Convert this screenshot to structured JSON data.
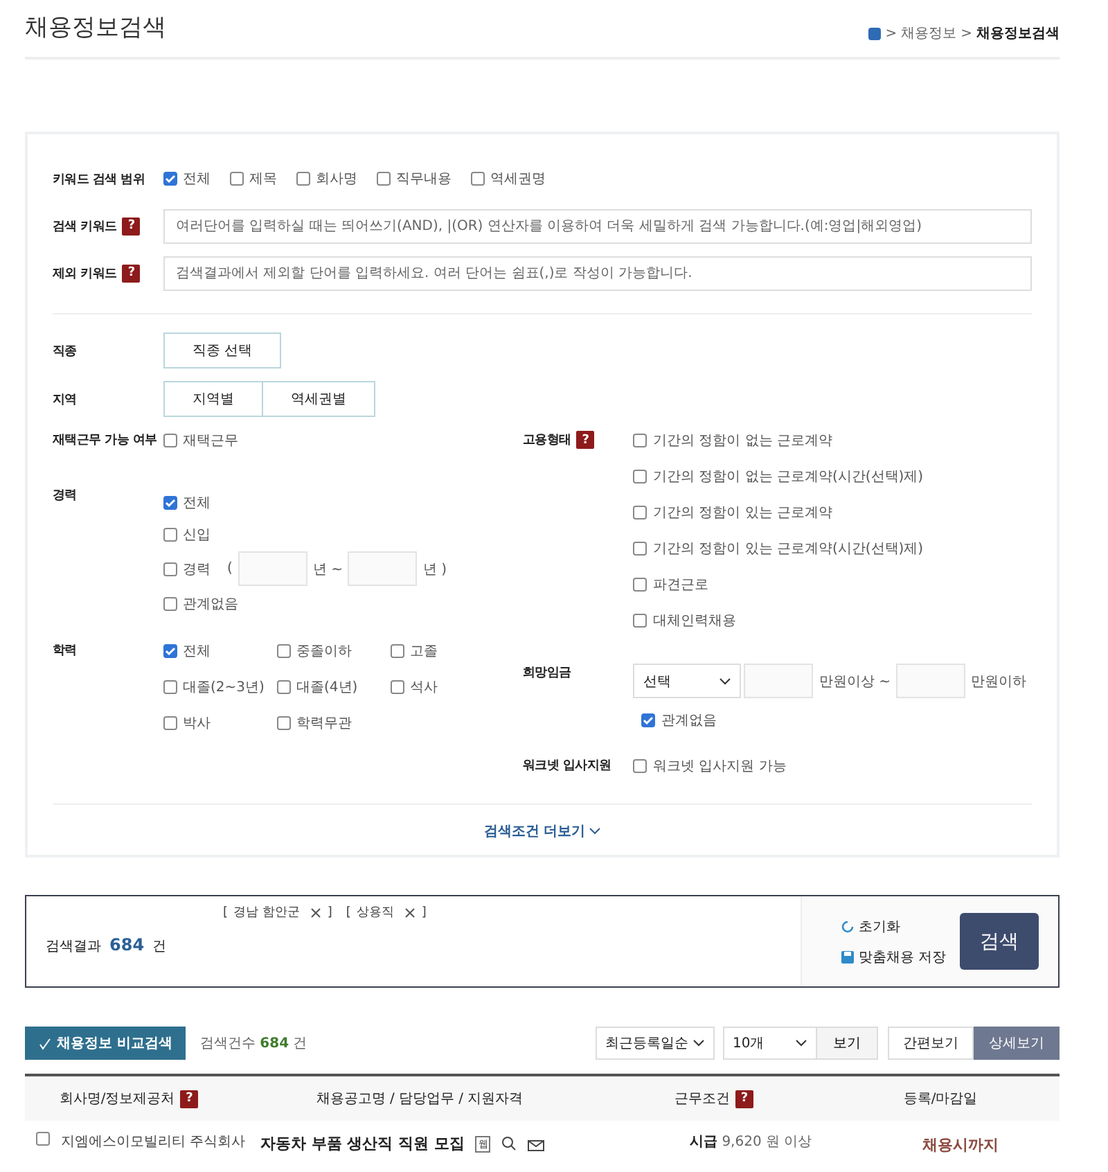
{
  "title": "채용정보검색",
  "breadcrumb": [
    {
      "sep": ">",
      "label": "채용정보"
    },
    {
      "sep": ">",
      "label": "채용정보검색"
    }
  ],
  "keyword_scope": {
    "label": "키워드 검색 범위",
    "options": [
      {
        "label": "전체",
        "checked": true
      },
      {
        "label": "제목",
        "checked": false
      },
      {
        "label": "회사명",
        "checked": false
      },
      {
        "label": "직무내용",
        "checked": false
      },
      {
        "label": "역세권명",
        "checked": false
      }
    ]
  },
  "keyword": {
    "label": "검색 키워드",
    "help": "?",
    "placeholder": "여러단어를 입력하실 때는 띄어쓰기(AND), |(OR) 연산자를 이용하여 더욱 세밀하게 검색 가능합니다.(예:영업|해외영업)"
  },
  "exclude": {
    "label": "제외 키워드",
    "help": "?",
    "placeholder": "검색결과에서 제외할 단어를 입력하세요. 여러 단어는 쉼표(,)로 작성이 가능합니다."
  },
  "job_type": {
    "label": "직종",
    "buttons": [
      "직종 선택"
    ]
  },
  "region": {
    "label": "지역",
    "buttons": [
      "지역별",
      "역세권별"
    ]
  },
  "remote": {
    "label": "재택근무 가능 여부",
    "options": [
      {
        "label": "재택근무",
        "checked": false
      }
    ]
  },
  "career": {
    "label": "경력",
    "options": [
      {
        "kind": "check",
        "label": "전체",
        "checked": true
      },
      {
        "kind": "check",
        "label": "신입",
        "checked": false
      },
      {
        "kind": "range",
        "label": "경력",
        "checked": false,
        "open": "(",
        "from_unit": "년 ~",
        "to_unit": "년 )"
      },
      {
        "kind": "check",
        "label": "관계없음",
        "checked": false
      }
    ]
  },
  "education": {
    "label": "학력",
    "options": [
      {
        "label": "전체",
        "checked": true
      },
      {
        "label": "중졸이하",
        "checked": false
      },
      {
        "label": "고졸",
        "checked": false
      },
      {
        "label": "대졸(2~3년)",
        "checked": false
      },
      {
        "label": "대졸(4년)",
        "checked": false
      },
      {
        "label": "석사",
        "checked": false
      },
      {
        "label": "박사",
        "checked": false
      },
      {
        "label": "학력무관",
        "checked": false
      }
    ]
  },
  "employment": {
    "label": "고용형태",
    "help": "?",
    "options": [
      {
        "label": "기간의 정함이 없는 근로계약",
        "checked": false
      },
      {
        "label": "기간의 정함이 없는 근로계약(시간(선택)제)",
        "checked": false
      },
      {
        "label": "기간의 정함이 있는 근로계약",
        "checked": false
      },
      {
        "label": "기간의 정함이 있는 근로계약(시간(선택)제)",
        "checked": false
      },
      {
        "label": "파견근로",
        "checked": false
      },
      {
        "label": "대체인력채용",
        "checked": false
      }
    ]
  },
  "wage": {
    "label": "희망임금",
    "select": "선택",
    "min_unit": "만원이상 ~",
    "max_unit": "만원이하",
    "any": {
      "label": "관계없음",
      "checked": true
    }
  },
  "worknet": {
    "label": "워크넷 입사지원",
    "options": [
      {
        "label": "워크넷 입사지원 가능",
        "checked": false
      }
    ]
  },
  "more": "검색조건 더보기",
  "result": {
    "tags": [
      {
        "open": "[",
        "label": "경남 함안군",
        "close": "]"
      },
      {
        "open": "[",
        "label": "상용직",
        "close": "]"
      }
    ],
    "label": "검색결과",
    "count": "684",
    "unit": "건",
    "reset": "초기화",
    "save": "맞춤채용 저장",
    "search": "검색"
  },
  "toolbar": {
    "compare": "채용정보 비교검색",
    "count_label": "검색건수",
    "count": "684",
    "unit": "건",
    "sort": "최근등록일순",
    "per_page": "10개",
    "view": "보기",
    "modes": [
      {
        "label": "간편보기",
        "selected": false
      },
      {
        "label": "상세보기",
        "selected": true
      }
    ]
  },
  "table": {
    "columns": [
      {
        "label": "회사명/정보제공처",
        "help": "?"
      },
      {
        "label": "채용공고명 / 담당업무 / 지원자격"
      },
      {
        "label": "근무조건",
        "help": "?"
      },
      {
        "label": "등록/마감일"
      }
    ],
    "rows": [
      {
        "checked": false,
        "company": "지엠에스이모빌리티 주식회사",
        "title": "자동차 부품 생산직 직원 모집",
        "badge": "웹",
        "wage_label": "시급",
        "wage": "9,620 원 이상",
        "deadline": "채용시까지"
      }
    ]
  }
}
